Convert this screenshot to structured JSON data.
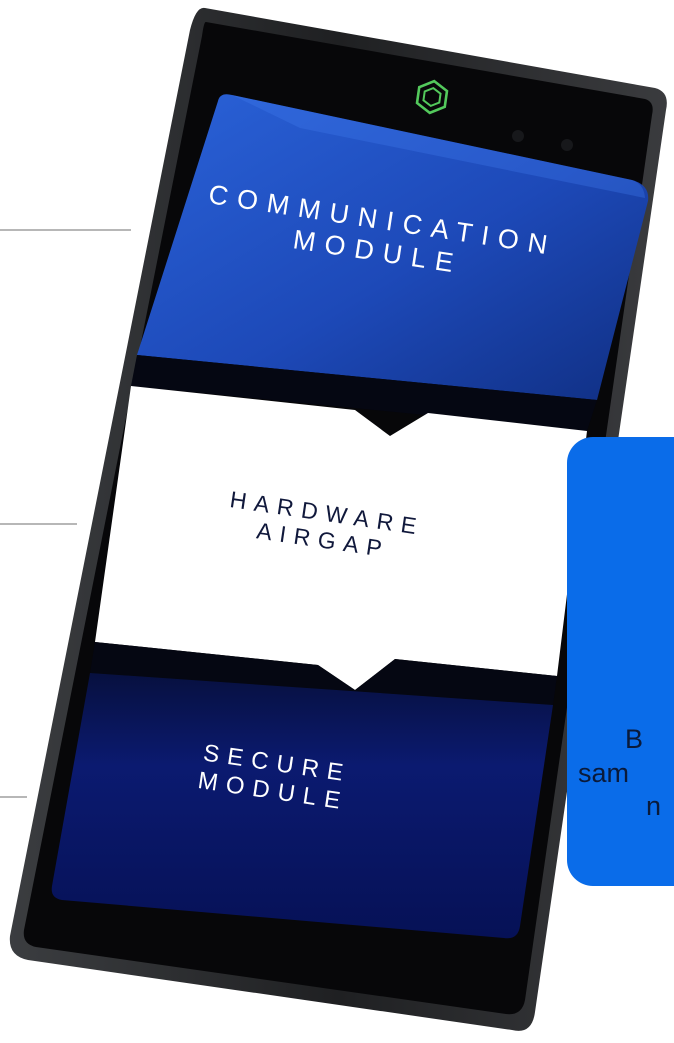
{
  "colors": {
    "background": "#ffffff",
    "connector": "#b7b7b7",
    "phone_frame": "#2a2b2d",
    "phone_bezel": "#070709",
    "comm_module_blue": "#1f4fc4",
    "airgap_white": "#ffffff",
    "secure_module_navy": "#0b176a",
    "logo_green": "#53c95c",
    "card_blue": "#0a6ce9",
    "card_text": "#0a1a3a"
  },
  "phone": {
    "logo_icon": "hexagon-logo-icon",
    "modules": {
      "communication": [
        "COMMUNICATION",
        "MODULE"
      ],
      "airgap": [
        "HARDWARE",
        "AIRGAP"
      ],
      "secure": [
        "SECURE",
        "MODULE"
      ]
    }
  },
  "info_card": {
    "lines": [
      "B",
      "sam",
      "n"
    ]
  }
}
